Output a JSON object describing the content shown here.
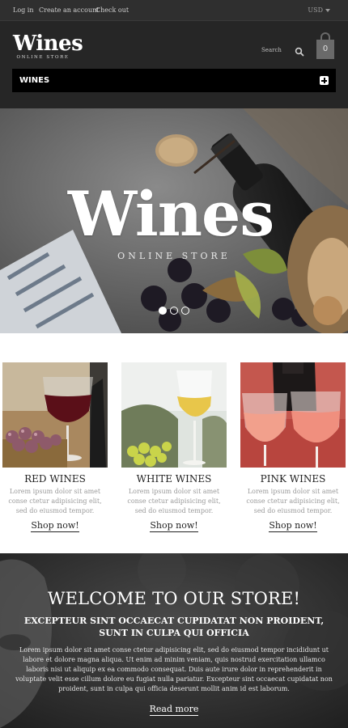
{
  "topbar": {
    "login": "Log in",
    "create_account": "Create an account",
    "checkout": "Check out",
    "currency": "USD"
  },
  "header": {
    "logo_title": "Wines",
    "logo_subtitle": "ONLINE STORE",
    "search_label": "Search",
    "cart_count": "0",
    "nav_label": "WINES"
  },
  "hero": {
    "title": "Wines",
    "subtitle": "ONLINE STORE",
    "slides": 3,
    "active_slide": 1
  },
  "products": [
    {
      "name": "RED WINES",
      "description": "Lorem ipsum dolor sit amet conse ctetur adipisicing elit, sed do eiusmod tempor.",
      "link": "Shop now!"
    },
    {
      "name": "WHITE WINES",
      "description": "Lorem ipsum dolor sit amet conse ctetur adipisicing elit, sed do eiusmod tempor.",
      "link": "Shop now!"
    },
    {
      "name": "PINK WINES",
      "description": "Lorem ipsum dolor sit amet conse ctetur adipisicing elit, sed do eiusmod tempor.",
      "link": "Shop now!"
    }
  ],
  "welcome": {
    "title": "WELCOME TO OUR STORE!",
    "subtitle": "EXCEPTEUR SINT OCCAECAT CUPIDATAT NON PROIDENT, SUNT IN CULPA QUI OFFICIA",
    "body": "Lorem ipsum dolor sit amet conse ctetur adipisicing elit, sed do eiusmod tempor incididunt ut labore et dolore magna aliqua. Ut enim ad minim veniam, quis nostrud exercitation ullamco laboris nisi ut aliquip ex ea commodo consequat. Duis aute irure dolor in reprehenderit in voluptate velit esse cillum dolore eu fugiat nulla pariatur. Excepteur sint occaecat cupidatat non proident, sunt in culpa qui officia deserunt mollit anim id est laborum.",
    "link": "Read more"
  }
}
